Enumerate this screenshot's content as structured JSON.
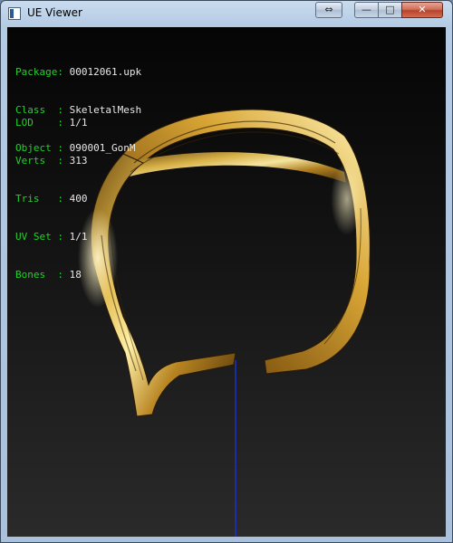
{
  "window": {
    "title": "UE Viewer",
    "buttons": {
      "resize": "⇔",
      "minimize": "—",
      "maximize": "□",
      "close": "✕"
    }
  },
  "info": {
    "package": {
      "label": "Package: ",
      "value": "00012061.upk"
    },
    "class": {
      "label": "Class  : ",
      "value": "SkeletalMesh"
    },
    "object": {
      "label": "Object : ",
      "value": "090001_GonM"
    },
    "lod": {
      "label": "LOD    : ",
      "value": "1/1"
    },
    "verts": {
      "label": "Verts  : ",
      "value": "313"
    },
    "tris": {
      "label": "Tris   : ",
      "value": "400"
    },
    "uvset": {
      "label": "UV Set : ",
      "value": "1/1"
    },
    "bones": {
      "label": "Bones  : ",
      "value": "18"
    }
  },
  "colors": {
    "info_label": "#22d12a",
    "info_value": "#e8e8e8",
    "gold": "#d9a52b",
    "axis": "#1c2fd0"
  }
}
